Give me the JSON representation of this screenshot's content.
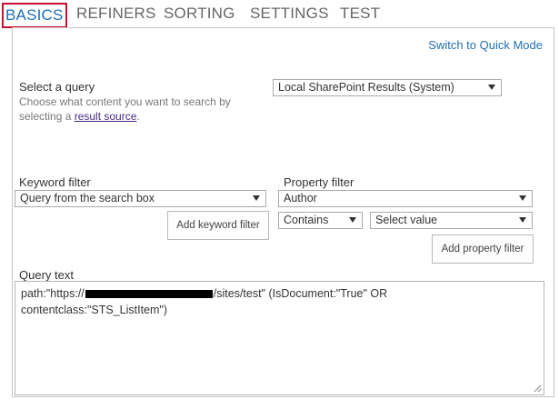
{
  "tabs": [
    {
      "label": "BASICS",
      "active": true
    },
    {
      "label": "REFINERS",
      "active": false
    },
    {
      "label": "SORTING",
      "active": false
    },
    {
      "label": "SETTINGS",
      "active": false
    },
    {
      "label": "TEST",
      "active": false
    }
  ],
  "quick_mode_link": "Switch to Quick Mode",
  "query": {
    "label": "Select a query",
    "desc_before": "Choose what content you want to search by selecting a ",
    "desc_link": "result source",
    "desc_after": ".",
    "selected": "Local SharePoint Results (System)"
  },
  "keyword_filter": {
    "label": "Keyword filter",
    "selected": "Query from the search box",
    "add_button": "Add keyword filter"
  },
  "property_filter": {
    "label": "Property filter",
    "property": "Author",
    "operator": "Contains",
    "value": "Select value",
    "add_button": "Add property filter"
  },
  "query_text": {
    "label": "Query text",
    "part1": "path:\"https://",
    "part2": "/sites/test\"  (IsDocument:\"True\" OR",
    "part3": "contentclass:\"STS_ListItem\")"
  },
  "colors": {
    "accent": "#1f6fb3",
    "active_tab_border": "#c8102e",
    "link_visited": "#4a2b86"
  }
}
